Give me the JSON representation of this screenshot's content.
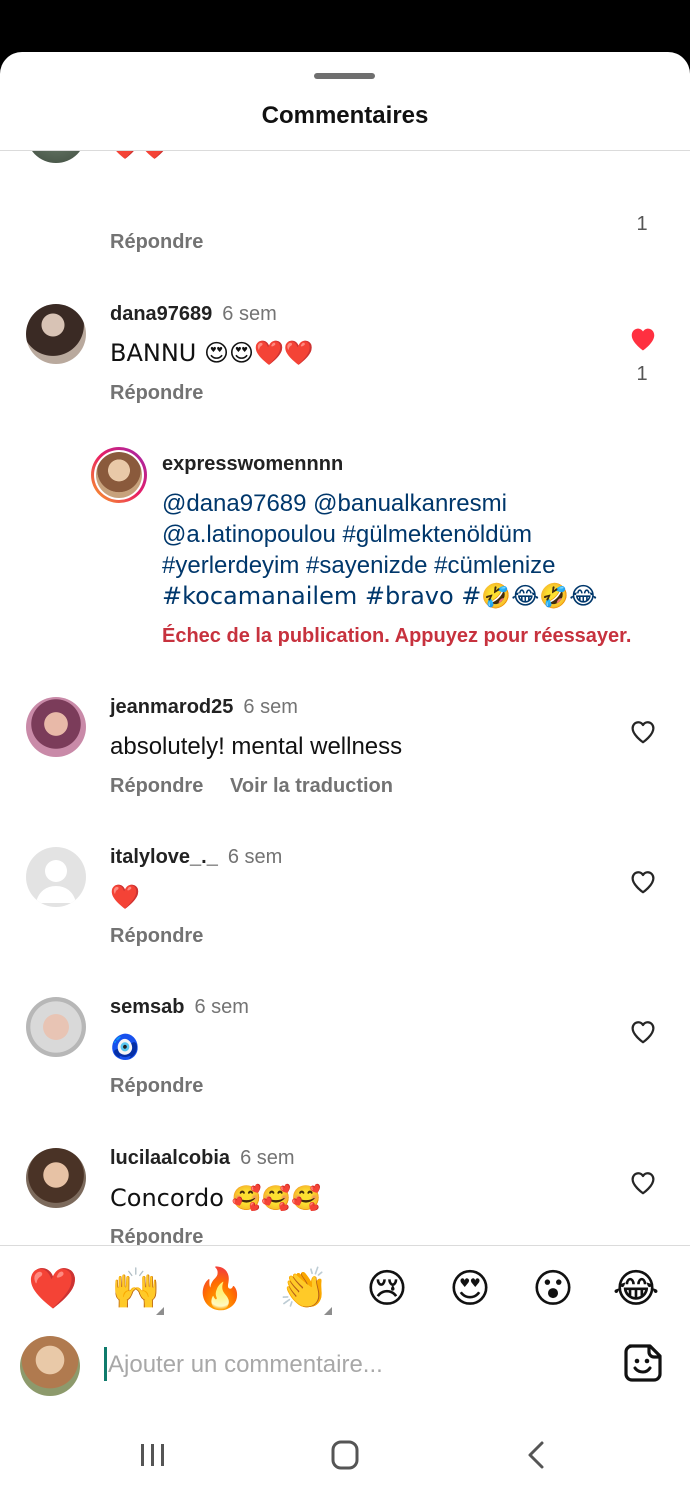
{
  "sheet": {
    "title": "Commentaires"
  },
  "top_partial": {
    "text": "❤️❤️",
    "reply": "Répondre",
    "likes": "1"
  },
  "comments": [
    {
      "username": "dana97689",
      "time": "6 sem",
      "text": "BANNU 😍😍❤️❤️",
      "reply": "Répondre",
      "likes": "1",
      "liked": true
    },
    {
      "username": "jeanmarod25",
      "time": "6 sem",
      "text": "absolutely! mental wellness",
      "reply": "Répondre",
      "translate": "Voir la traduction"
    },
    {
      "username": "italylove_._",
      "time": "6 sem",
      "text": "❤️",
      "reply": "Répondre"
    },
    {
      "username": "semsab",
      "time": "6 sem",
      "text": "🧿",
      "reply": "Répondre"
    },
    {
      "username": "lucilaalcobia",
      "time": "6 sem",
      "text": "Concordo 🥰🥰🥰",
      "reply": "Répondre"
    }
  ],
  "pending_reply": {
    "username": "expresswomennnn",
    "lines": [
      "@dana97689 @banualkanresmi",
      "@a.latinopoulou #gülmektenöldüm",
      "#yerlerdeyim #sayenizde #cümlenize",
      "#kocamanailem #bravo #🤣😂🤣😂"
    ],
    "error": "Échec de la publication. Appuyez pour réessayer."
  },
  "emoji_bar": [
    "❤️",
    "🙌",
    "🔥",
    "👏",
    "😢",
    "😍",
    "😮",
    "😂"
  ],
  "composer": {
    "placeholder": "Ajouter un commentaire..."
  },
  "colors": {
    "like_red": "#ff3040",
    "fail_red": "#c7323e",
    "mention_blue": "#00376b",
    "muted": "#737373"
  },
  "icons": {
    "like": "heart-icon",
    "sticker": "sticker-icon",
    "nav_recent": "recent-apps-icon",
    "nav_home": "home-icon",
    "nav_back": "back-icon"
  }
}
